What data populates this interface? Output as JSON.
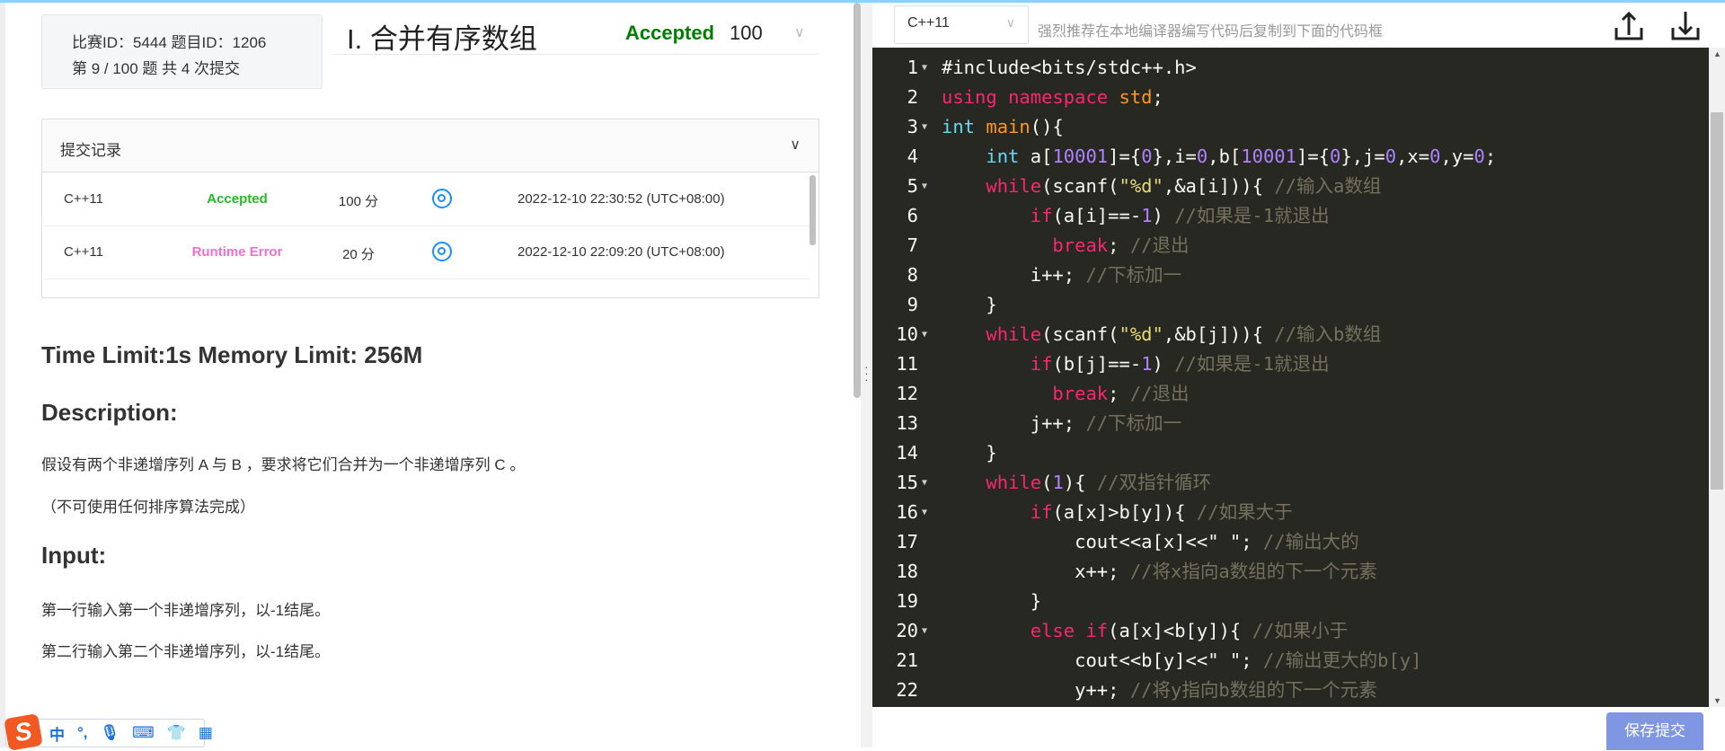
{
  "problem_info": {
    "line1": "比赛ID：5444   题目ID：1206",
    "line2": "第 9 / 100 题    共 4 次提交"
  },
  "problem": {
    "title": "I. 合并有序数组",
    "verdict": "Accepted",
    "score": "100"
  },
  "records": {
    "header": "提交记录",
    "rows": [
      {
        "lang": "C++11",
        "status": "Accepted",
        "status_color": "#22bb22",
        "score": "100 分",
        "time": "2022-12-10 22:30:52 (UTC+08:00)"
      },
      {
        "lang": "C++11",
        "status": "Runtime Error",
        "status_color": "#f06fd0",
        "score": "20 分",
        "time": "2022-12-10 22:09:20 (UTC+08:00)"
      }
    ]
  },
  "statement": {
    "limits": "Time Limit:1s Memory Limit: 256M",
    "description_heading": "Description:",
    "description": [
      "假设有两个非递增序列 A 与 B ，要求将它们合并为一个非递增序列 C 。",
      "（不可使用任何排序算法完成）"
    ],
    "input_heading": "Input:",
    "input": [
      "第一行输入第一个非递增序列，以-1结尾。",
      "第二行输入第二个非递增序列，以-1结尾。"
    ]
  },
  "ime": {
    "mode": "中",
    "punct": "°,"
  },
  "editor": {
    "language": "C++11",
    "hint": "强烈推荐在本地编译器编写代码后复制到下面的代码框",
    "save_label": "保存提交",
    "lines": [
      {
        "n": "1",
        "fold": true,
        "t": [
          [
            "",
            "#include<bits/stdc++.h>"
          ]
        ]
      },
      {
        "n": "2",
        "t": [
          [
            "kw",
            "using"
          ],
          [
            "",
            " "
          ],
          [
            "kw",
            "namespace"
          ],
          [
            "",
            " "
          ],
          [
            "fn",
            "std"
          ],
          [
            "",
            ";"
          ]
        ]
      },
      {
        "n": "3",
        "fold": true,
        "t": [
          [
            "ty",
            "int"
          ],
          [
            "",
            " "
          ],
          [
            "fn",
            "main"
          ],
          [
            "",
            "(){"
          ]
        ]
      },
      {
        "n": "4",
        "t": [
          [
            "",
            "    "
          ],
          [
            "ty",
            "int"
          ],
          [
            "",
            " a["
          ],
          [
            "nu",
            "10001"
          ],
          [
            "",
            "]={"
          ],
          [
            "nu",
            "0"
          ],
          [
            "",
            "},i="
          ],
          [
            "nu",
            "0"
          ],
          [
            "",
            ",b["
          ],
          [
            "nu",
            "10001"
          ],
          [
            "",
            "]={"
          ],
          [
            "nu",
            "0"
          ],
          [
            "",
            "},j="
          ],
          [
            "nu",
            "0"
          ],
          [
            "",
            ",x="
          ],
          [
            "nu",
            "0"
          ],
          [
            "",
            ",y="
          ],
          [
            "nu",
            "0"
          ],
          [
            "",
            ";"
          ]
        ]
      },
      {
        "n": "5",
        "fold": true,
        "t": [
          [
            "",
            "    "
          ],
          [
            "kw",
            "while"
          ],
          [
            "",
            "(scanf("
          ],
          [
            "str",
            "\"%d\""
          ],
          [
            "",
            ",&a[i])){ "
          ],
          [
            "cm",
            "//输入a数组"
          ]
        ]
      },
      {
        "n": "6",
        "t": [
          [
            "",
            "        "
          ],
          [
            "kw",
            "if"
          ],
          [
            "",
            "(a[i]==-"
          ],
          [
            "nu",
            "1"
          ],
          [
            "",
            ") "
          ],
          [
            "cm",
            "//如果是-1就退出"
          ]
        ]
      },
      {
        "n": "7",
        "t": [
          [
            "",
            "          "
          ],
          [
            "kw",
            "break"
          ],
          [
            "",
            "; "
          ],
          [
            "cm",
            "//退出"
          ]
        ]
      },
      {
        "n": "8",
        "t": [
          [
            "",
            "        i++; "
          ],
          [
            "cm",
            "//下标加一"
          ]
        ]
      },
      {
        "n": "9",
        "t": [
          [
            "",
            "    }"
          ]
        ]
      },
      {
        "n": "10",
        "fold": true,
        "t": [
          [
            "",
            "    "
          ],
          [
            "kw",
            "while"
          ],
          [
            "",
            "(scanf("
          ],
          [
            "str",
            "\"%d\""
          ],
          [
            "",
            ",&b[j])){ "
          ],
          [
            "cm",
            "//输入b数组"
          ]
        ]
      },
      {
        "n": "11",
        "t": [
          [
            "",
            "        "
          ],
          [
            "kw",
            "if"
          ],
          [
            "",
            "(b[j]==-"
          ],
          [
            "nu",
            "1"
          ],
          [
            "",
            ") "
          ],
          [
            "cm",
            "//如果是-1就退出"
          ]
        ]
      },
      {
        "n": "12",
        "t": [
          [
            "",
            "          "
          ],
          [
            "kw",
            "break"
          ],
          [
            "",
            "; "
          ],
          [
            "cm",
            "//退出"
          ]
        ]
      },
      {
        "n": "13",
        "t": [
          [
            "",
            "        j++; "
          ],
          [
            "cm",
            "//下标加一"
          ]
        ]
      },
      {
        "n": "14",
        "t": [
          [
            "",
            "    }"
          ]
        ]
      },
      {
        "n": "15",
        "fold": true,
        "t": [
          [
            "",
            "    "
          ],
          [
            "kw",
            "while"
          ],
          [
            "",
            "("
          ],
          [
            "nu",
            "1"
          ],
          [
            "",
            "){ "
          ],
          [
            "cm",
            "//双指针循环"
          ]
        ]
      },
      {
        "n": "16",
        "fold": true,
        "t": [
          [
            "",
            "        "
          ],
          [
            "kw",
            "if"
          ],
          [
            "",
            "(a[x]>b[y]){ "
          ],
          [
            "cm",
            "//如果大于"
          ]
        ]
      },
      {
        "n": "17",
        "t": [
          [
            "",
            "            cout<<a[x]<<\" \"; "
          ],
          [
            "cm",
            "//输出大的"
          ]
        ]
      },
      {
        "n": "18",
        "t": [
          [
            "",
            "            x++; "
          ],
          [
            "cm",
            "//将x指向a数组的下一个元素"
          ]
        ]
      },
      {
        "n": "19",
        "t": [
          [
            "",
            "        }"
          ]
        ]
      },
      {
        "n": "20",
        "fold": true,
        "t": [
          [
            "",
            "        "
          ],
          [
            "kw",
            "else"
          ],
          [
            "",
            " "
          ],
          [
            "kw",
            "if"
          ],
          [
            "",
            "(a[x]<b[y]){ "
          ],
          [
            "cm",
            "//如果小于"
          ]
        ]
      },
      {
        "n": "21",
        "t": [
          [
            "",
            "            cout<<b[y]<<\" \"; "
          ],
          [
            "cm",
            "//输出更大的b[y]"
          ]
        ]
      },
      {
        "n": "22",
        "t": [
          [
            "",
            "            y++; "
          ],
          [
            "cm",
            "//将y指向b数组的下一个元素"
          ]
        ]
      }
    ]
  }
}
